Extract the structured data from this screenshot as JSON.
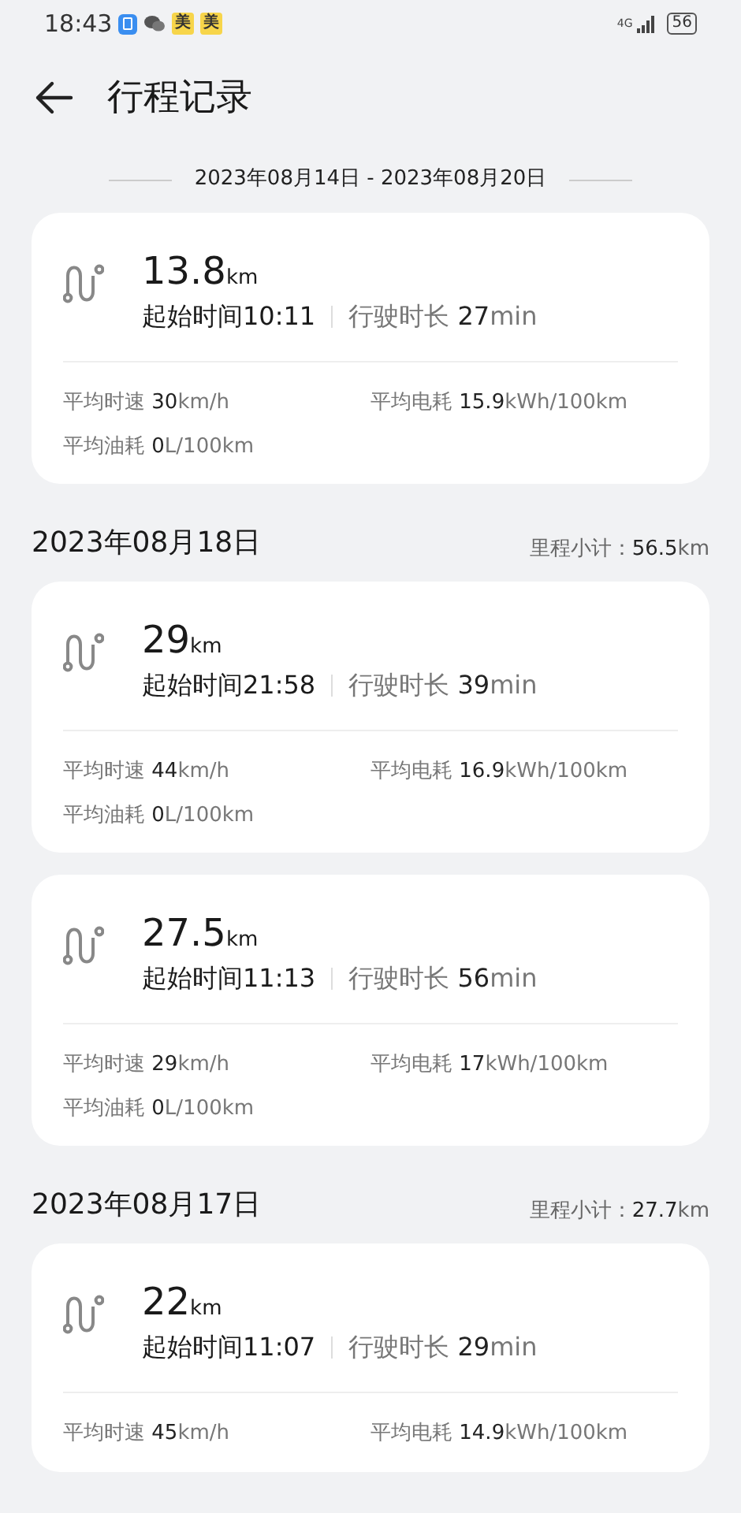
{
  "status_bar": {
    "time": "18:43",
    "notifications": [
      {
        "kind": "blue-app"
      },
      {
        "kind": "chat-app"
      },
      {
        "kind": "text-app",
        "glyph": "美"
      },
      {
        "kind": "text-app",
        "glyph": "美"
      }
    ],
    "network": "4G",
    "battery": "56"
  },
  "title": "行程记录",
  "range": "2023年08月14日 - 2023年08月20日",
  "sections": [
    {
      "trips": [
        {
          "distance": "13.8",
          "unit": "km",
          "start": "起始时间10:11",
          "duration": "行驶时长 **27**min",
          "stats": [
            "平均时速 **30**km/h",
            "平均电耗 **15.9**kWh/100km",
            "平均油耗 **0**L/100km"
          ]
        }
      ]
    },
    {
      "date": "2023年08月18日",
      "subtotal": "里程小计：**56.5**km",
      "trips": [
        {
          "distance": "29",
          "unit": "km",
          "start": "起始时间21:58",
          "duration": "行驶时长 **39**min",
          "stats": [
            "平均时速 **44**km/h",
            "平均电耗 **16.9**kWh/100km",
            "平均油耗 **0**L/100km"
          ]
        },
        {
          "distance": "27.5",
          "unit": "km",
          "start": "起始时间11:13",
          "duration": "行驶时长 **56**min",
          "stats": [
            "平均时速 **29**km/h",
            "平均电耗 **17**kWh/100km",
            "平均油耗 **0**L/100km"
          ]
        }
      ]
    },
    {
      "date": "2023年08月17日",
      "subtotal": "里程小计：**27.7**km",
      "trips": [
        {
          "distance": "22",
          "unit": "km",
          "start": "起始时间11:07",
          "duration": "行驶时长 **29**min",
          "stats": [
            "平均时速 **45**km/h",
            "平均电耗 **14.9**kWh/100km"
          ]
        }
      ]
    }
  ]
}
